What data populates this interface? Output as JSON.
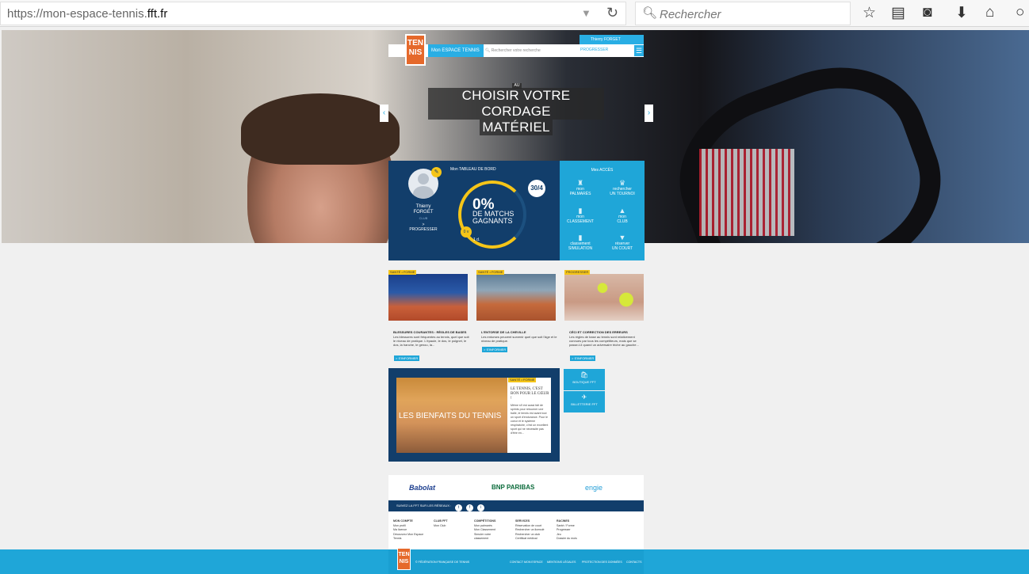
{
  "browser": {
    "url_prefix": "https://mon-espace-tennis.",
    "url_domain": "fft.fr",
    "search_placeholder": "Rechercher"
  },
  "site": {
    "logo_top": "TEN",
    "logo_bottom": "NIS",
    "brand": "Mon ESPACE TENNIS",
    "search_placeholder": "Rechercher votre recherche",
    "user_name": "Thierry FORGET",
    "user_sub": "PROGRESSER",
    "menu_icon": "☰"
  },
  "hero": {
    "tag": "AU",
    "title_line1": "CHOISIR VOTRE CORDAGE",
    "title_line2": "MATÉRIEL",
    "prev": "‹",
    "next": "›"
  },
  "dashboard": {
    "title": "Mon TABLEAU DE BORD",
    "first_name": "Thierry",
    "last_name": "FORGET",
    "club": "CLUB",
    "profile_link": "> PROGRESSER",
    "rank": "30/4",
    "pct": "0%",
    "pct_label": "DE MATCHS GAGNANTS",
    "small_badge": "0 v",
    "days": "1 d.",
    "win_fraction": 0.72
  },
  "access": {
    "title": "Mes ACCÈS",
    "items": [
      {
        "top": "mon",
        "label": "PALMARÈS",
        "icon": "♜"
      },
      {
        "top": "rechercher",
        "label": "UN TOURNOI",
        "icon": "♛"
      },
      {
        "top": "mon",
        "label": "CLASSEMENT",
        "icon": "▮"
      },
      {
        "top": "mon",
        "label": "CLUB",
        "icon": "▲"
      },
      {
        "top": "classement",
        "label": "SIMULATION",
        "icon": "▮"
      },
      {
        "top": "réserver",
        "label": "UN COURT",
        "icon": "▼"
      }
    ]
  },
  "articles": [
    {
      "tag": "SANTÉ • FORME",
      "title": "BLESSURES COURANTES : RÈGLES DE BASES",
      "text": "Les blessures sont fréquentes au tennis, quel que soit le niveau de pratique. L'épaule, le dos, le poignet, le dos, la hanche, le genou, la...",
      "btn": "> S'INFORMER"
    },
    {
      "tag": "SANTÉ • FORME",
      "title": "L'ENTORSE DE LA CHEVILLE",
      "text": "Les entorses peuvent survenir quel que soit l'âge et le niveau de pratique.",
      "btn": "> S'INFORMER"
    },
    {
      "tag": "PROGRESSER",
      "title": "CÉCI ET CORRECTION DES ERREURS",
      "text": "Les règles de base au tennis sont relativement connues par tous les compétiteurs, mais que se passe-t-il quand un adversaire triche au gauche...",
      "btn": "> S'INFORMER"
    }
  ],
  "feature": {
    "tag": "SANTÉ • FORME",
    "title": "LES BIENFAITS DU TENNIS",
    "headline": "LE TENNIS, C'EST BON POUR LE CŒUR !",
    "text": "Même s'il est aussi fait de sprints pour retourner une balle, le tennis est avant tout un sport d'endurance. Pour le coeur et le système respiratoire, c'est un excellent sport qui ne nécessite pas d'être en...",
    "side_btn1": "BOUTIQUE FFT",
    "side_btn2": "BILLETTERIE FFT"
  },
  "partners": [
    "Babolat",
    "BNP PARIBAS",
    "engie"
  ],
  "social_label": "SUIVEZ LA FFT SUR LES RÉSEAUX :",
  "social_icons": [
    "t",
    "f",
    "i"
  ],
  "footer_cols": [
    {
      "head": "MON COMPTE",
      "items": [
        "Mon profil",
        "Ma licence",
        "Découvrez Mon Espace",
        "Tennis"
      ]
    },
    {
      "head": "CLUB FFT",
      "items": [
        "Mon Club"
      ]
    },
    {
      "head": "COMPÉTITIONS",
      "items": [
        "Mon palmarès",
        "Mon Classement",
        "Simuler votre",
        "classement"
      ]
    },
    {
      "head": "SERVICES",
      "items": [
        "Réservation de court",
        "Rechercher un licencié",
        "Rechercher un club",
        "Certificat médical"
      ]
    },
    {
      "head": "RACINES",
      "items": [
        "Santé / Forme",
        "Progresser",
        "Jeu",
        "Dossier du mois"
      ]
    }
  ],
  "footer": {
    "logo_top": "TEN",
    "logo_bottom": "NIS",
    "copyright": "© FÉDÉRATION FRANÇAISE DE TENNIS",
    "links": [
      "CONTACT MON ESPACE",
      "MENTIONS LÉGALES",
      "PROTECTION DES DONNÉES",
      "CONTACTS"
    ]
  },
  "colors": {
    "accent": "#1fa6d8",
    "navy": "#123e6b",
    "yellow": "#f5c518",
    "orange": "#e5692b"
  }
}
